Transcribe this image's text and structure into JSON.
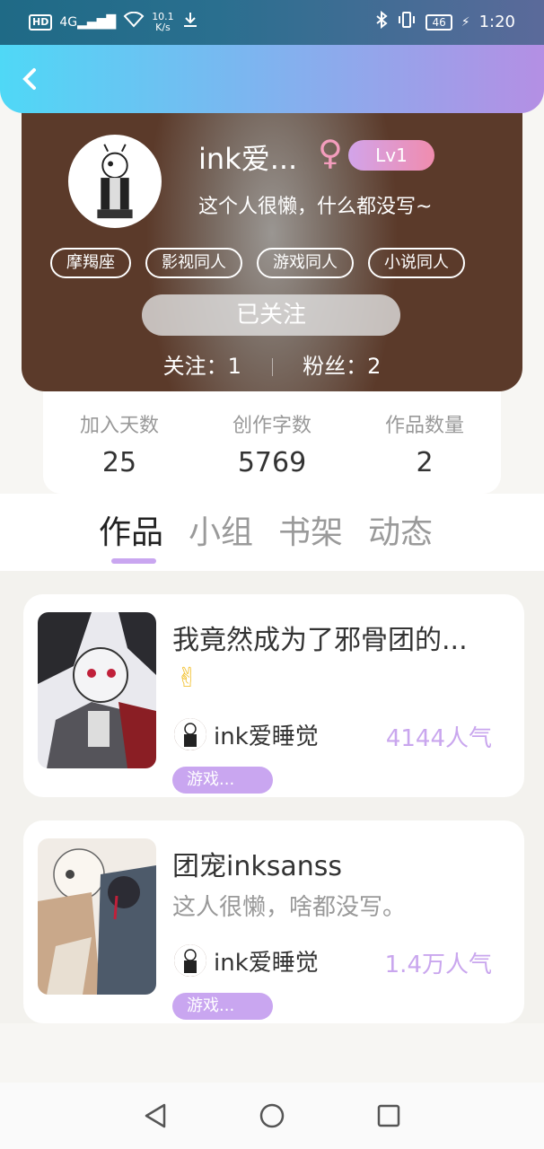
{
  "status_bar": {
    "network": "HD",
    "signal": "4G",
    "speed_value": "10.1",
    "speed_unit": "K/s",
    "battery": "46",
    "time": "1:20"
  },
  "profile": {
    "username": "ink爱...",
    "gender_symbol": "♀",
    "level": "Lv1",
    "signature": "这个人很懒，什么都没写~",
    "tags": [
      "摩羯座",
      "影视同人",
      "游戏同人",
      "小说同人"
    ],
    "follow_button": "已关注",
    "following_label": "关注：1",
    "fans_label": "粉丝：2"
  },
  "stats": [
    {
      "label": "加入天数",
      "value": "25"
    },
    {
      "label": "创作字数",
      "value": "5769"
    },
    {
      "label": "作品数量",
      "value": "2"
    }
  ],
  "tabs": [
    "作品",
    "小组",
    "书架",
    "动态"
  ],
  "works": [
    {
      "title": "我竟然成为了邪骨团的...",
      "desc": "✌",
      "author": "ink爱睡觉",
      "popularity": "4144人气",
      "category": "游戏..."
    },
    {
      "title": "团宠inksanss",
      "desc": "这人很懒，啥都没写。",
      "author": "ink爱睡觉",
      "popularity": "1.4万人气",
      "category": "游戏..."
    }
  ],
  "colors": {
    "accent": "#c9a6f0",
    "header_gradient_start": "#4fd8f6",
    "header_gradient_end": "#b48fe4"
  }
}
